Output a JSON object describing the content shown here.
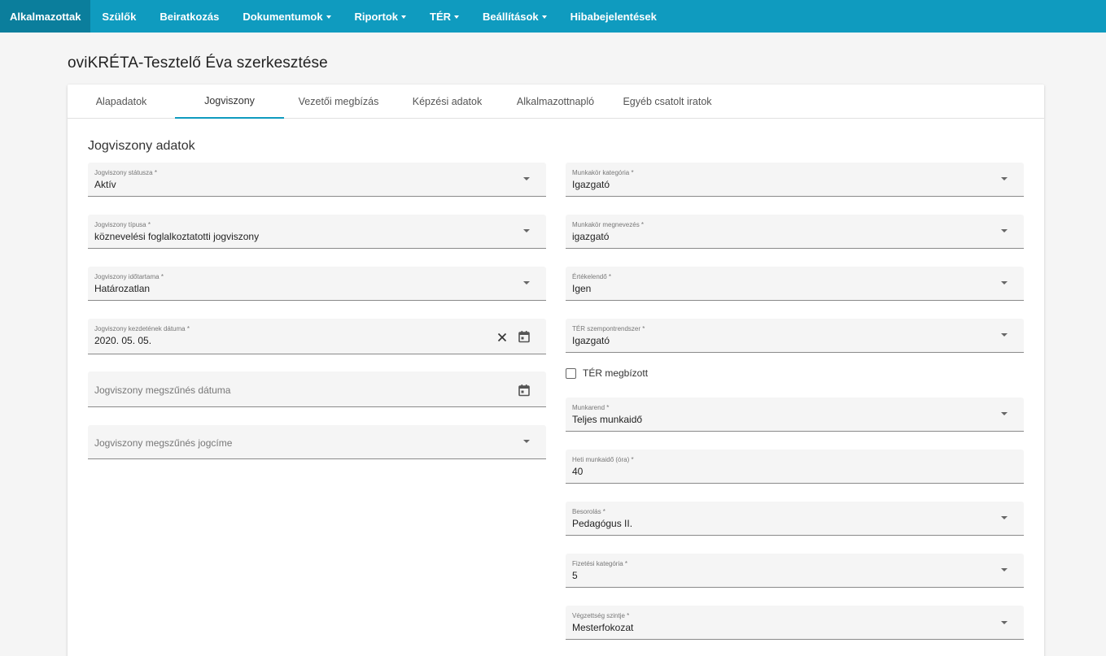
{
  "nav": {
    "items": [
      {
        "label": "Alkalmazottak"
      },
      {
        "label": "Szülők"
      },
      {
        "label": "Beiratkozás"
      },
      {
        "label": "Dokumentumok"
      },
      {
        "label": "Riportok"
      },
      {
        "label": "TÉR"
      },
      {
        "label": "Beállítások"
      },
      {
        "label": "Hibabejelentések"
      }
    ]
  },
  "page": {
    "title": "oviKRÉTA-Tesztelő Éva szerkesztése"
  },
  "tabs": [
    {
      "label": "Alapadatok"
    },
    {
      "label": "Jogviszony"
    },
    {
      "label": "Vezetői megbízás"
    },
    {
      "label": "Képzési adatok"
    },
    {
      "label": "Alkalmazottnapló"
    },
    {
      "label": "Egyéb csatolt iratok"
    }
  ],
  "section": {
    "title": "Jogviszony adatok"
  },
  "left": {
    "status": {
      "label": "Jogviszony státusza *",
      "value": "Aktív"
    },
    "type": {
      "label": "Jogviszony típusa *",
      "value": "köznevelési foglalkoztatotti jogviszony"
    },
    "duration": {
      "label": "Jogviszony időtartama *",
      "value": "Határozatlan"
    },
    "start_date": {
      "label": "Jogviszony kezdetének dátuma *",
      "value": "2020. 05. 05."
    },
    "end_date": {
      "placeholder": "Jogviszony megszűnés dátuma"
    },
    "end_reason": {
      "placeholder": "Jogviszony megszűnés jogcíme"
    }
  },
  "right": {
    "job_category": {
      "label": "Munkakör kategória *",
      "value": "Igazgató"
    },
    "job_name": {
      "label": "Munkakör megnevezés *",
      "value": "igazgató"
    },
    "evaluated": {
      "label": "Értékelendő *",
      "value": "Igen"
    },
    "ter_system": {
      "label": "TÉR szempontrendszer *",
      "value": "Igazgató"
    },
    "ter_delegate": {
      "label": "TÉR megbízott",
      "checked": false
    },
    "work_schedule": {
      "label": "Munkarend *",
      "value": "Teljes munkaidő"
    },
    "weekly_hours": {
      "label": "Heti munkaidő (óra) *",
      "value": "40"
    },
    "classification": {
      "label": "Besorolás *",
      "value": "Pedagógus II."
    },
    "pay_category": {
      "label": "Fizetési kategória *",
      "value": "5"
    },
    "education_level": {
      "label": "Végzettség szintje *",
      "value": "Mesterfokozat"
    }
  },
  "colors": {
    "nav_bg": "#0f9bbf",
    "nav_active": "#0b7e9c",
    "tab_underline": "#0f9bbf"
  }
}
